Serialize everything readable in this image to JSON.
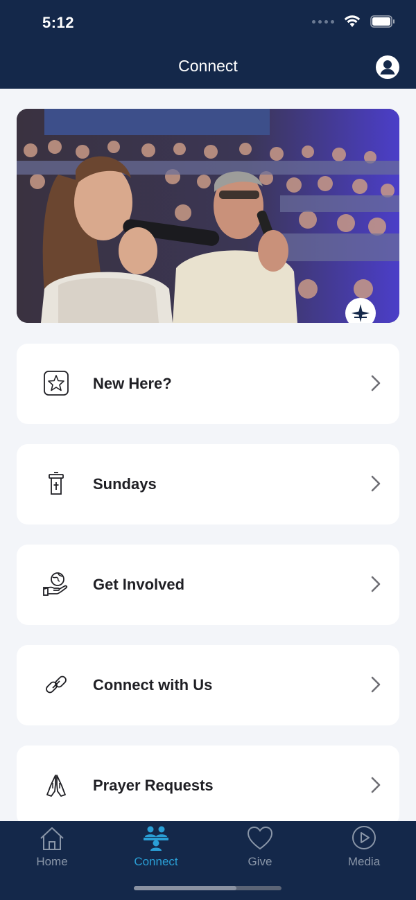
{
  "status_bar": {
    "time": "5:12"
  },
  "header": {
    "title": "Connect"
  },
  "menu": {
    "items": [
      {
        "label": "New Here?",
        "icon": "star-badge-icon"
      },
      {
        "label": "Sundays",
        "icon": "pulpit-icon"
      },
      {
        "label": "Get Involved",
        "icon": "hand-globe-icon"
      },
      {
        "label": "Connect with Us",
        "icon": "link-icon"
      },
      {
        "label": "Prayer Requests",
        "icon": "praying-hands-icon"
      }
    ]
  },
  "tabbar": {
    "tabs": [
      {
        "label": "Home",
        "icon": "home-icon",
        "active": false
      },
      {
        "label": "Connect",
        "icon": "people-icon",
        "active": true
      },
      {
        "label": "Give",
        "icon": "heart-icon",
        "active": false
      },
      {
        "label": "Media",
        "icon": "play-circle-icon",
        "active": false
      }
    ]
  },
  "colors": {
    "header_bg": "#14284a",
    "active_tab": "#2a9fd6",
    "inactive_tab": "#8a96a8",
    "page_bg": "#f3f5f9"
  }
}
